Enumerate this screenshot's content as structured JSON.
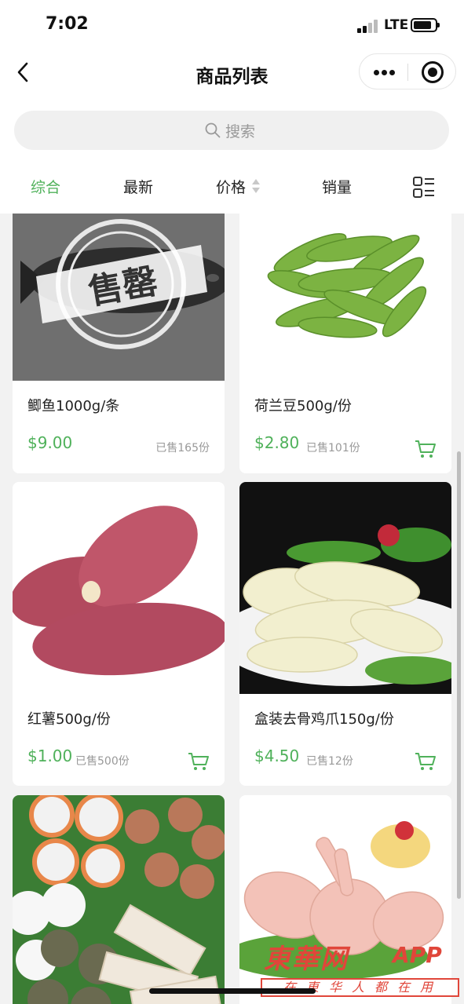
{
  "status_bar": {
    "time": "7:02",
    "network": "LTE"
  },
  "nav": {
    "title": "商品列表"
  },
  "search": {
    "placeholder": "搜索"
  },
  "tabs": [
    {
      "label": "综合",
      "active": true
    },
    {
      "label": "最新"
    },
    {
      "label": "价格"
    },
    {
      "label": "销量"
    }
  ],
  "products": [
    {
      "name": "鲫鱼1000g/条",
      "price": "$9.00",
      "sold": "已售165份",
      "image_stamp": "售罄"
    },
    {
      "name": "荷兰豆500g/份",
      "price": "$2.80",
      "sold": "已售101份"
    },
    {
      "name": "红薯500g/份",
      "price": "$1.00",
      "sold": "已售500份"
    },
    {
      "name": "盒装去骨鸡爪150g/份",
      "price": "$4.50",
      "sold": "已售12份"
    },
    {
      "name": "",
      "price": "",
      "sold": ""
    },
    {
      "name": "",
      "price": "",
      "sold": ""
    }
  ],
  "watermark": {
    "logo": "東華网",
    "app": "APP",
    "tagline": "在東华人都在用"
  },
  "colors": {
    "accent": "#4fb15a",
    "watermark": "#e0463a"
  }
}
